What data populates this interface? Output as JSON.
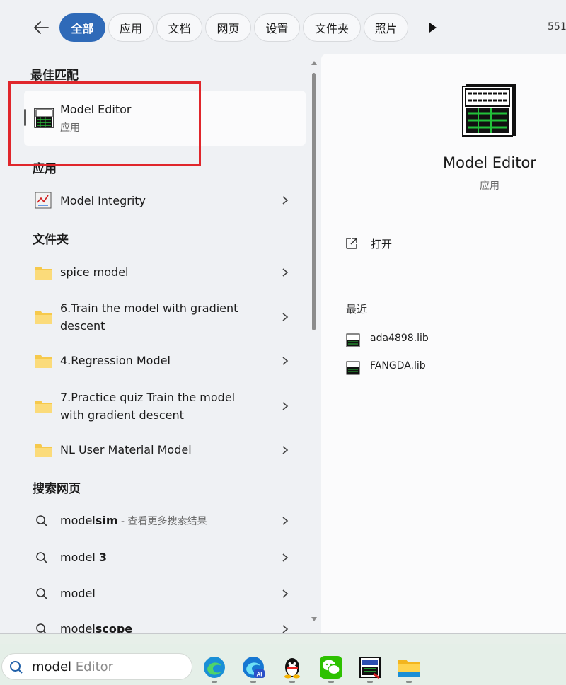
{
  "tabs": [
    {
      "label": "全部",
      "active": true
    },
    {
      "label": "应用"
    },
    {
      "label": "文档"
    },
    {
      "label": "网页"
    },
    {
      "label": "设置"
    },
    {
      "label": "文件夹"
    },
    {
      "label": "照片"
    }
  ],
  "tab_overflow_count": "551",
  "sections": {
    "best_match": "最佳匹配",
    "apps": "应用",
    "folders": "文件夹",
    "web": "搜索网页"
  },
  "best_match": {
    "title": "Model Editor",
    "subtitle": "应用"
  },
  "apps": [
    {
      "title": "Model Integrity"
    }
  ],
  "folders": [
    {
      "line1": "spice model",
      "line2": ""
    },
    {
      "line1": "6.Train the model with gradient",
      "line2": "descent"
    },
    {
      "line1": "4.Regression Model",
      "line2": ""
    },
    {
      "line1": "7.Practice quiz Train the model",
      "line2": "with gradient descent"
    },
    {
      "line1": "NL User Material Model",
      "line2": ""
    }
  ],
  "web_results": [
    {
      "prefix": "model",
      "bold": "sim",
      "suffix": " - 查看更多搜索结果"
    },
    {
      "prefix": "model ",
      "bold": "3",
      "suffix": ""
    },
    {
      "prefix": "model",
      "bold": "",
      "suffix": ""
    },
    {
      "prefix": "model",
      "bold": "scope",
      "suffix": ""
    }
  ],
  "detail": {
    "name": "Model Editor",
    "type": "应用",
    "open_label": "打开",
    "recent_header": "最近",
    "recent": [
      "ada4898.lib",
      "FANGDA.lib"
    ]
  },
  "taskbar": {
    "search_typed": "model ",
    "search_ghost": "Editor",
    "icons": [
      "edge-icon",
      "edge-ai-icon",
      "qq-icon",
      "wechat-icon",
      "model-editor-icon",
      "file-explorer-icon"
    ]
  },
  "colors": {
    "accent": "#2f6ab8",
    "highlight_box": "#e0262b"
  }
}
